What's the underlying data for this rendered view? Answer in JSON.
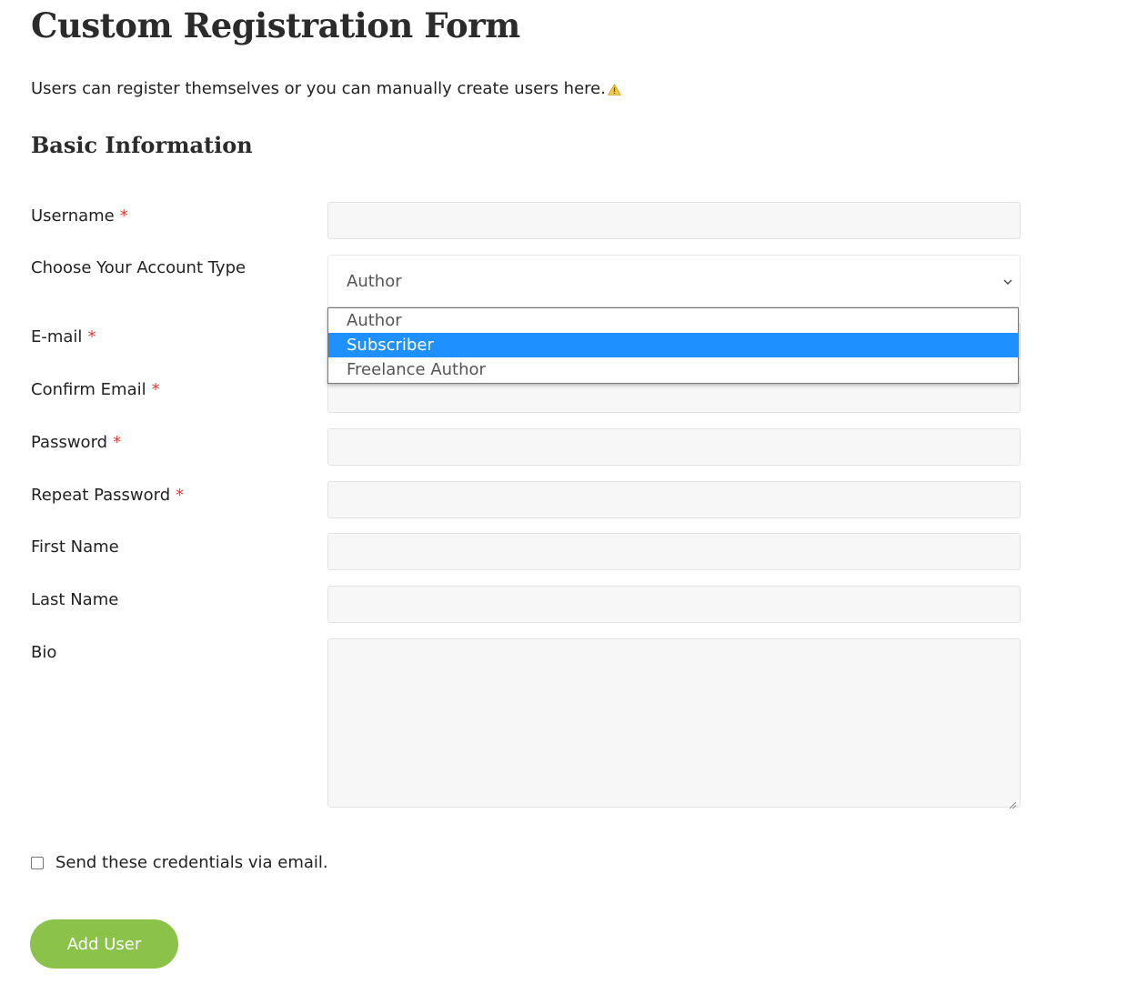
{
  "page": {
    "title": "Custom Registration Form",
    "intro": "Users can register themselves or you can manually create users here.",
    "intro_icon": "warning-icon"
  },
  "section": {
    "title": "Basic Information"
  },
  "fields": {
    "username": {
      "label": "Username",
      "required_mark": "*",
      "value": ""
    },
    "account_type": {
      "label": "Choose Your Account Type",
      "selected": "Author",
      "options": [
        "Author",
        "Subscriber",
        "Freelance Author"
      ],
      "highlighted_option": "Subscriber",
      "icon": "chevron-down-icon"
    },
    "email": {
      "label": "E-mail",
      "required_mark": "*",
      "value": ""
    },
    "confirm_email": {
      "label": "Confirm Email",
      "required_mark": "*",
      "value": ""
    },
    "password": {
      "label": "Password",
      "required_mark": "*",
      "value": ""
    },
    "repeat_password": {
      "label": "Repeat Password",
      "required_mark": "*",
      "value": ""
    },
    "first_name": {
      "label": "First Name",
      "value": ""
    },
    "last_name": {
      "label": "Last Name",
      "value": ""
    },
    "bio": {
      "label": "Bio",
      "value": ""
    }
  },
  "send_credentials": {
    "label": "Send these credentials via email.",
    "checked": false
  },
  "submit": {
    "label": "Add User"
  },
  "colors": {
    "required": "#e53935",
    "button_bg": "#8bc34a",
    "option_highlight": "#1e90ff",
    "input_bg": "#f7f7f7"
  }
}
